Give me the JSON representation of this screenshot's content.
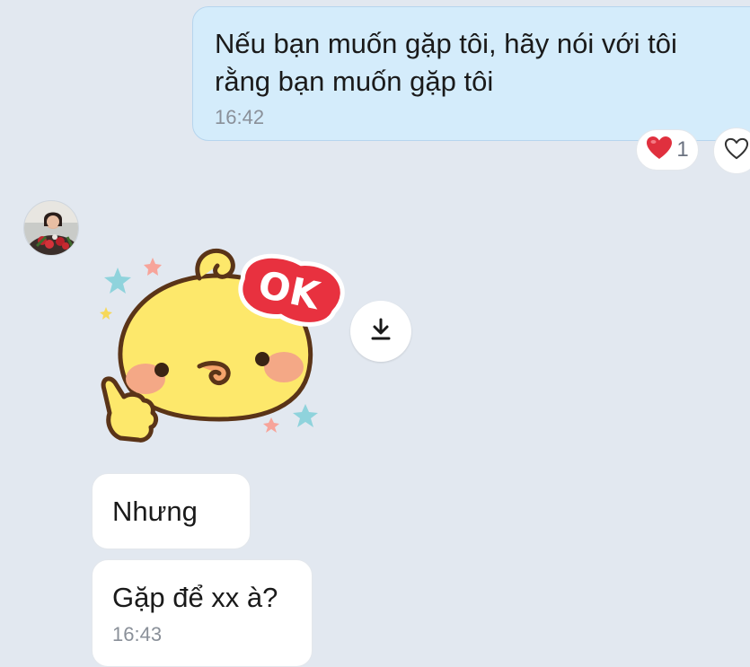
{
  "conversation": {
    "outgoing_message": {
      "text": "Nếu bạn muốn gặp tôi, hãy nói với tôi\nrằng bạn muốn gặp tôi",
      "time": "16:42",
      "reaction": {
        "icon": "red-heart-icon",
        "count": "1"
      }
    },
    "incoming": {
      "sticker": {
        "badge_text": "OK",
        "icon": "yellow-chick-ok-sticker"
      },
      "messages": [
        {
          "text": "Nhưng",
          "time": ""
        },
        {
          "text": "Gặp để xx à?",
          "time": "16:43"
        }
      ]
    }
  },
  "icons": {
    "like": "heart-outline-icon",
    "download": "download-icon",
    "avatar": "user-avatar"
  },
  "colors": {
    "background": "#e2e8f0",
    "outgoing_bubble": "#d4ecfb",
    "incoming_bubble": "#ffffff",
    "heart": "#e0303e",
    "sticker_yellow": "#fde86b",
    "ok_badge": "#e8313f"
  }
}
